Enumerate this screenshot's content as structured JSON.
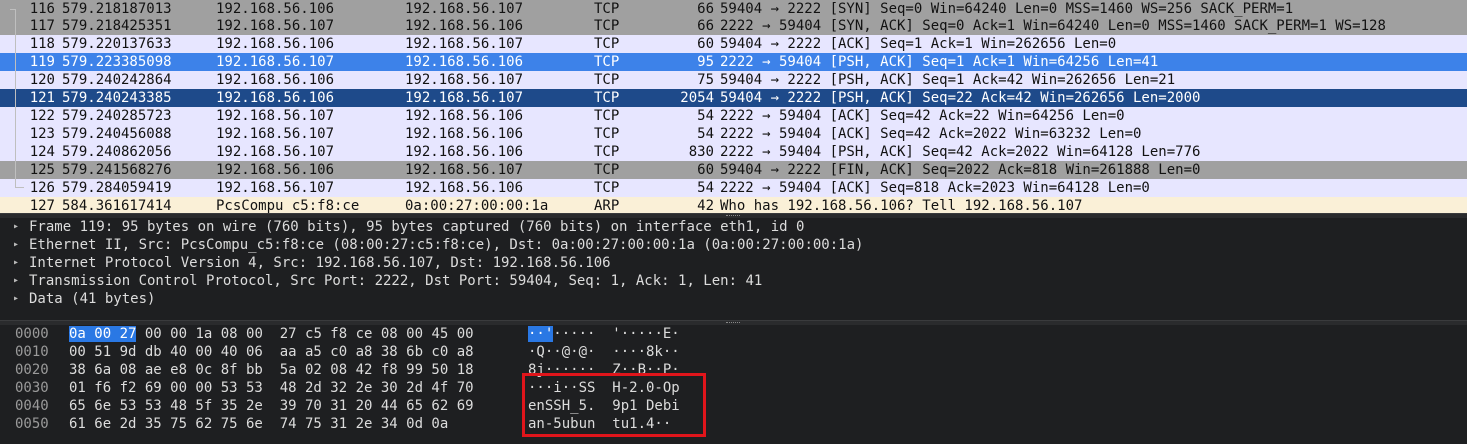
{
  "packets": [
    {
      "no": "116",
      "time": "579.218187013",
      "src": "192.168.56.106",
      "dst": "192.168.56.107",
      "proto": "TCP",
      "len": "66",
      "info": "59404 → 2222 [SYN] Seq=0 Win=64240 Len=0 MSS=1460 WS=256 SACK_PERM=1",
      "bg": "#a0a0a0",
      "fg": "#121212"
    },
    {
      "no": "117",
      "time": "579.218425351",
      "src": "192.168.56.107",
      "dst": "192.168.56.106",
      "proto": "TCP",
      "len": "66",
      "info": "2222 → 59404 [SYN, ACK] Seq=0 Ack=1 Win=64240 Len=0 MSS=1460 SACK_PERM=1 WS=128",
      "bg": "#a0a0a0",
      "fg": "#121212"
    },
    {
      "no": "118",
      "time": "579.220137633",
      "src": "192.168.56.106",
      "dst": "192.168.56.107",
      "proto": "TCP",
      "len": "60",
      "info": "59404 → 2222 [ACK] Seq=1 Ack=1 Win=262656 Len=0",
      "bg": "#e7e6ff",
      "fg": "#121212"
    },
    {
      "no": "119",
      "time": "579.223385098",
      "src": "192.168.56.107",
      "dst": "192.168.56.106",
      "proto": "TCP",
      "len": "95",
      "info": "2222 → 59404 [PSH, ACK] Seq=1 Ack=1 Win=64256 Len=41",
      "bg": "#3d82e9",
      "fg": "#ffffff"
    },
    {
      "no": "120",
      "time": "579.240242864",
      "src": "192.168.56.106",
      "dst": "192.168.56.107",
      "proto": "TCP",
      "len": "75",
      "info": "59404 → 2222 [PSH, ACK] Seq=1 Ack=42 Win=262656 Len=21",
      "bg": "#e7e6ff",
      "fg": "#121212"
    },
    {
      "no": "121",
      "time": "579.240243385",
      "src": "192.168.56.106",
      "dst": "192.168.56.107",
      "proto": "TCP",
      "len": "2054",
      "info": "59404 → 2222 [PSH, ACK] Seq=22 Ack=42 Win=262656 Len=2000",
      "bg": "#1e4a8a",
      "fg": "#ffffff"
    },
    {
      "no": "122",
      "time": "579.240285723",
      "src": "192.168.56.107",
      "dst": "192.168.56.106",
      "proto": "TCP",
      "len": "54",
      "info": "2222 → 59404 [ACK] Seq=42 Ack=22 Win=64256 Len=0",
      "bg": "#e7e6ff",
      "fg": "#121212"
    },
    {
      "no": "123",
      "time": "579.240456088",
      "src": "192.168.56.107",
      "dst": "192.168.56.106",
      "proto": "TCP",
      "len": "54",
      "info": "2222 → 59404 [ACK] Seq=42 Ack=2022 Win=63232 Len=0",
      "bg": "#e7e6ff",
      "fg": "#121212"
    },
    {
      "no": "124",
      "time": "579.240862056",
      "src": "192.168.56.107",
      "dst": "192.168.56.106",
      "proto": "TCP",
      "len": "830",
      "info": "2222 → 59404 [PSH, ACK] Seq=42 Ack=2022 Win=64128 Len=776",
      "bg": "#e7e6ff",
      "fg": "#121212"
    },
    {
      "no": "125",
      "time": "579.241568276",
      "src": "192.168.56.106",
      "dst": "192.168.56.107",
      "proto": "TCP",
      "len": "60",
      "info": "59404 → 2222 [FIN, ACK] Seq=2022 Ack=818 Win=261888 Len=0",
      "bg": "#a0a0a0",
      "fg": "#121212"
    },
    {
      "no": "126",
      "time": "579.284059419",
      "src": "192.168.56.107",
      "dst": "192.168.56.106",
      "proto": "TCP",
      "len": "54",
      "info": "2222 → 59404 [ACK] Seq=818 Ack=2023 Win=64128 Len=0",
      "bg": "#e7e6ff",
      "fg": "#121212"
    },
    {
      "no": "127",
      "time": "584.361617414",
      "src": "PcsCompu_c5:f8:ce",
      "dst": "0a:00:27:00:00:1a",
      "proto": "ARP",
      "len": "42",
      "info": "Who has 192.168.56.106? Tell 192.168.56.107",
      "bg": "#faf0d7",
      "fg": "#121212"
    }
  ],
  "details": [
    {
      "icon": "chevron-right-icon",
      "text": "Frame 119: 95 bytes on wire (760 bits), 95 bytes captured (760 bits) on interface eth1, id 0"
    },
    {
      "icon": "chevron-right-icon",
      "text": "Ethernet II, Src: PcsCompu_c5:f8:ce (08:00:27:c5:f8:ce), Dst: 0a:00:27:00:00:1a (0a:00:27:00:00:1a)"
    },
    {
      "icon": "chevron-right-icon",
      "text": "Internet Protocol Version 4, Src: 192.168.56.107, Dst: 192.168.56.106"
    },
    {
      "icon": "chevron-right-icon",
      "text": "Transmission Control Protocol, Src Port: 2222, Dst Port: 59404, Seq: 1, Ack: 1, Len: 41"
    },
    {
      "icon": "chevron-right-icon",
      "text": "Data (41 bytes)"
    }
  ],
  "bytes": [
    {
      "offset": "0000",
      "hex_hl": "0a 00 27",
      "hex": " 00 00 1a 08 00  27 c5 f8 ce 08 00 45 00",
      "ascii_hl": "··'",
      "ascii": "·····  '·····E·"
    },
    {
      "offset": "0010",
      "hex_hl": "",
      "hex": "00 51 9d db 40 00 40 06  aa a5 c0 a8 38 6b c0 a8",
      "ascii_hl": "",
      "ascii": "·Q··@·@·  ····8k··"
    },
    {
      "offset": "0020",
      "hex_hl": "",
      "hex": "38 6a 08 ae e8 0c 8f bb  5a 02 08 42 f8 99 50 18",
      "ascii_hl": "",
      "ascii": "8j······  Z··B··P·"
    },
    {
      "offset": "0030",
      "hex_hl": "",
      "hex": "01 f6 f2 69 00 00 53 53  48 2d 32 2e 30 2d 4f 70",
      "ascii_hl": "",
      "ascii": "···i··SS  H-2.0-Op"
    },
    {
      "offset": "0040",
      "hex_hl": "",
      "hex": "65 6e 53 53 48 5f 35 2e  39 70 31 20 44 65 62 69",
      "ascii_hl": "",
      "ascii": "enSSH_5.  9p1 Debi"
    },
    {
      "offset": "0050",
      "hex_hl": "",
      "hex": "61 6e 2d 35 75 62 75 6e  74 75 31 2e 34 0d 0a",
      "ascii_hl": "",
      "ascii": "an-5ubun  tu1.4··"
    }
  ]
}
